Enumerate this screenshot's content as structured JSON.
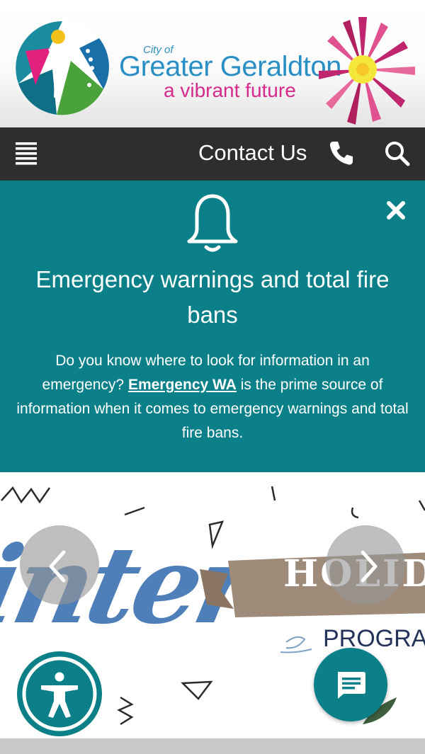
{
  "header": {
    "logo": {
      "small_text": "City of",
      "name": "Greater Geraldton",
      "tagline": "a vibrant future"
    }
  },
  "navbar": {
    "menu_icon": "hamburger-icon",
    "contact_label": "Contact Us",
    "phone_icon": "phone-icon",
    "search_icon": "search-icon"
  },
  "alert": {
    "icon": "bell-icon",
    "close_icon": "close-icon",
    "title": "Emergency warnings and total fire bans",
    "body_before": "Do you know where to look for information in an emergency? ",
    "link_text": "Emergency WA",
    "body_after": " is the prime source of information when it comes to emergency warnings and total fire bans.",
    "background": "#0b8088"
  },
  "carousel": {
    "slide_text_script": "inter",
    "slide_text_ribbon": "HOLID",
    "slide_text_program": "PROGRA",
    "prev_icon": "chevron-left-icon",
    "next_icon": "chevron-right-icon"
  },
  "floating": {
    "accessibility_icon": "accessibility-icon",
    "chat_icon": "chat-icon"
  },
  "colors": {
    "nav_bg": "#2e2e2e",
    "teal": "#0b8088",
    "brand_blue": "#2a8fc5",
    "brand_pink": "#d62a8c"
  }
}
